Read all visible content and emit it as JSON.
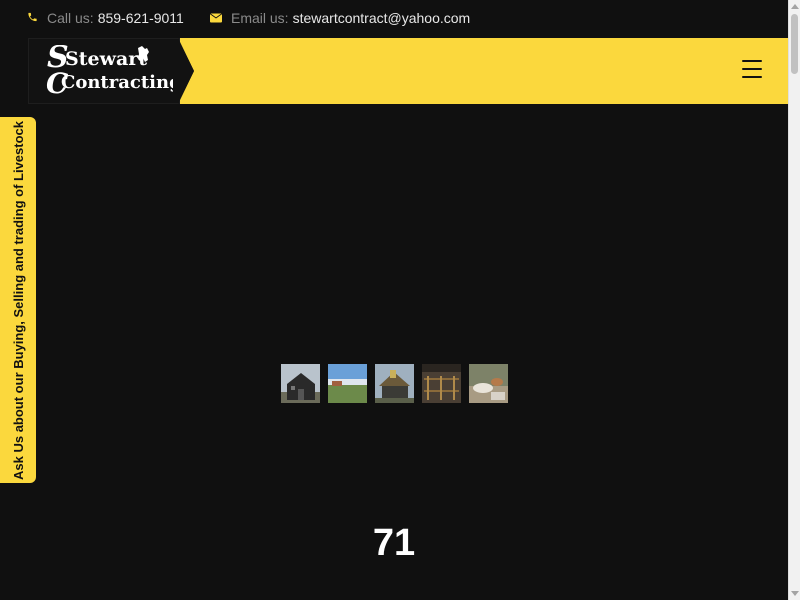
{
  "topbar": {
    "phone_label": "Call us:",
    "phone_value": "859-621-9011",
    "email_label": "Email us:",
    "email_value": "stewartcontract@yahoo.com"
  },
  "logo": {
    "line1": "Stewart",
    "line2": "Contracting"
  },
  "side_tab": {
    "label": "Ask Us about our Buying, Selling and trading of Livestock"
  },
  "gallery": {
    "thumbnails": [
      "barn-photo",
      "landscape-photo",
      "house-photo",
      "porch-photo",
      "interior-photo"
    ]
  },
  "counter": {
    "value": "71"
  },
  "colors": {
    "accent": "#fbd83d",
    "background": "#101010"
  }
}
